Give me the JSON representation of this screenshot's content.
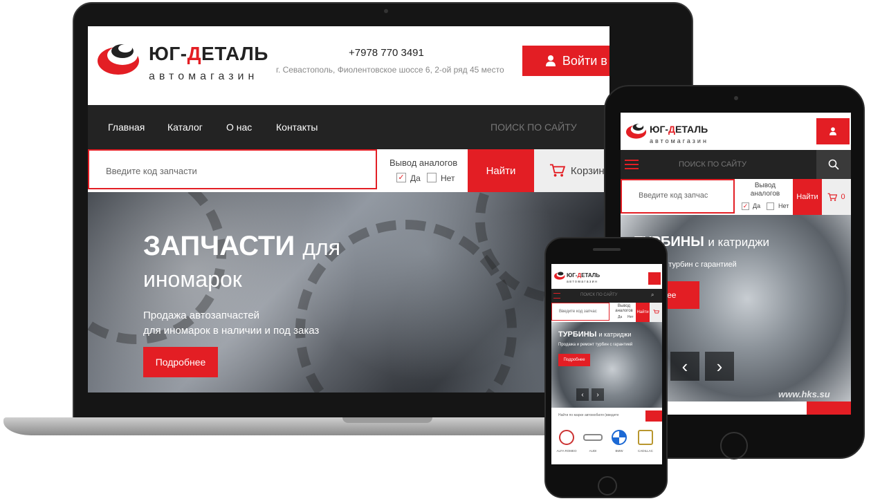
{
  "desktop": {
    "logo": {
      "title_part1": "ЮГ-",
      "title_part2": "Д",
      "title_part3": "ЕТАЛЬ",
      "subtitle": "автомагазин"
    },
    "contact": {
      "phone": "+7978 770 3491",
      "address": "г. Севастополь, Фиолентовское шоссе 6, 2-ой ряд 45 место"
    },
    "login_button": "Войти в ЛК",
    "nav": [
      "Главная",
      "Каталог",
      "О нас",
      "Контакты"
    ],
    "nav_search": "ПОИСК ПО САЙТУ",
    "search": {
      "placeholder": "Введите код запчасти",
      "analogs_title": "Вывод аналогов",
      "yes": "Да",
      "no": "Нет",
      "find": "Найти",
      "cart": "Корзина"
    },
    "hero": {
      "title_bold": "ЗАПЧАСТИ",
      "title_thin": "для",
      "title_line2": "иномарок",
      "text_line1": "Продажа автозапчастей",
      "text_line2": "для иномарок в наличии и под заказ",
      "button": "Подробнее"
    }
  },
  "tablet": {
    "logo": {
      "title_part1": "ЮГ-",
      "title_part2": "Д",
      "title_part3": "ЕТАЛЬ",
      "subtitle": "автомагазин"
    },
    "nav_search": "ПОИСК ПО САЙТУ",
    "search": {
      "placeholder": "Введите код запчас",
      "analogs_title": "Вывод аналогов",
      "yes": "Да",
      "no": "Нет",
      "find": "Найти",
      "cart_count": "0"
    },
    "hero": {
      "title_bold": "ТУРБИНЫ",
      "title_thin": "и катриджи",
      "text": "и ремонт турбин с гарантией",
      "button": "бнее",
      "watermark": "www.hks.su"
    }
  },
  "phone": {
    "logo": {
      "title_part1": "ЮГ-",
      "title_part2": "Д",
      "title_part3": "ЕТАЛЬ",
      "subtitle": "автомагазин"
    },
    "nav_search": "ПОИСК ПО САЙТУ",
    "search": {
      "placeholder": "Введите код запчас",
      "analogs_title": "Вывод аналогов",
      "yes": "Да",
      "no": "Нет",
      "find": "Найти"
    },
    "hero": {
      "title_bold": "ТУРБИНЫ",
      "title_thin": "и катриджи",
      "text": "Продажа и ремонт турбин с гарантией",
      "button": "Подробнее"
    },
    "find_by_brand": "Найти по марке автомобиля (введите",
    "brands": [
      "ALFA ROMEO",
      "AUDI",
      "BMW",
      "CADILLAC"
    ]
  },
  "colors": {
    "accent": "#e31e24",
    "nav_bg": "#232323"
  }
}
